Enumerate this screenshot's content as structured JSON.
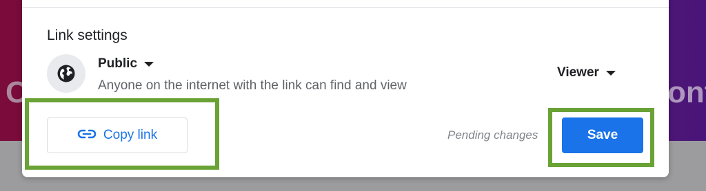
{
  "background": {
    "left_text": "C",
    "right_text": "ont"
  },
  "dialog": {
    "section_title": "Link settings",
    "access": {
      "icon": "globe-icon",
      "label": "Public",
      "description": "Anyone on the internet with the link can find and view"
    },
    "role": {
      "selected": "Viewer"
    },
    "copy_link": {
      "icon": "link-icon",
      "label": "Copy link"
    },
    "pending_text": "Pending changes",
    "save_label": "Save"
  },
  "colors": {
    "accent": "#1a73e8",
    "highlight": "#6aa236",
    "muted_text": "#5f6368"
  }
}
